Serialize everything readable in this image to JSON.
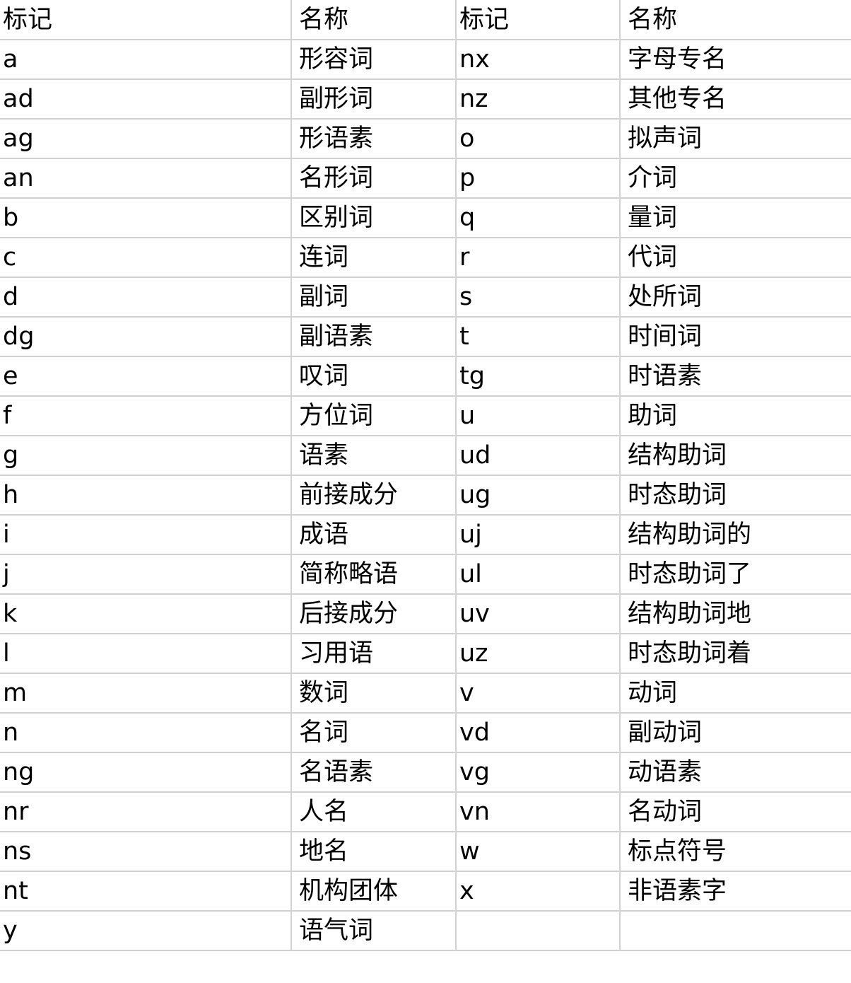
{
  "table": {
    "headers": {
      "tag": "标记",
      "name": "名称"
    },
    "left_rows": [
      {
        "tag": "a",
        "name": "形容词"
      },
      {
        "tag": "ad",
        "name": "副形词"
      },
      {
        "tag": "ag",
        "name": "形语素"
      },
      {
        "tag": "an",
        "name": "名形词"
      },
      {
        "tag": "b",
        "name": "区别词"
      },
      {
        "tag": "c",
        "name": "连词"
      },
      {
        "tag": "d",
        "name": "副词"
      },
      {
        "tag": "dg",
        "name": "副语素"
      },
      {
        "tag": "e",
        "name": "叹词"
      },
      {
        "tag": "f",
        "name": "方位词"
      },
      {
        "tag": "g",
        "name": "语素"
      },
      {
        "tag": "h",
        "name": "前接成分"
      },
      {
        "tag": "i",
        "name": "成语"
      },
      {
        "tag": "j",
        "name": "简称略语"
      },
      {
        "tag": "k",
        "name": "后接成分"
      },
      {
        "tag": "l",
        "name": "习用语"
      },
      {
        "tag": "m",
        "name": "数词"
      },
      {
        "tag": "n",
        "name": "名词"
      },
      {
        "tag": "ng",
        "name": "名语素"
      },
      {
        "tag": "nr",
        "name": "人名"
      },
      {
        "tag": "ns",
        "name": "地名"
      },
      {
        "tag": "nt",
        "name": "机构团体"
      },
      {
        "tag": "y",
        "name": "语气词"
      }
    ],
    "right_rows": [
      {
        "tag": "nx",
        "name": "字母专名"
      },
      {
        "tag": "nz",
        "name": "其他专名"
      },
      {
        "tag": "o",
        "name": "拟声词"
      },
      {
        "tag": "p",
        "name": "介词"
      },
      {
        "tag": "q",
        "name": "量词"
      },
      {
        "tag": "r",
        "name": "代词"
      },
      {
        "tag": "s",
        "name": "处所词"
      },
      {
        "tag": "t",
        "name": "时间词"
      },
      {
        "tag": "tg",
        "name": "时语素"
      },
      {
        "tag": "u",
        "name": "助词"
      },
      {
        "tag": "ud",
        "name": "结构助词"
      },
      {
        "tag": "ug",
        "name": "时态助词"
      },
      {
        "tag": "uj",
        "name": "结构助词的"
      },
      {
        "tag": "ul",
        "name": "时态助词了"
      },
      {
        "tag": "uv",
        "name": "结构助词地"
      },
      {
        "tag": "uz",
        "name": "时态助词着"
      },
      {
        "tag": "v",
        "name": "动词"
      },
      {
        "tag": "vd",
        "name": "副动词"
      },
      {
        "tag": "vg",
        "name": "动语素"
      },
      {
        "tag": "vn",
        "name": "名动词"
      },
      {
        "tag": "w",
        "name": "标点符号"
      },
      {
        "tag": "x",
        "name": "非语素字"
      },
      {
        "tag": "",
        "name": ""
      }
    ]
  },
  "style": {
    "border_color": "#d2d2d2",
    "text_color": "#000000",
    "background_color": "#ffffff"
  }
}
